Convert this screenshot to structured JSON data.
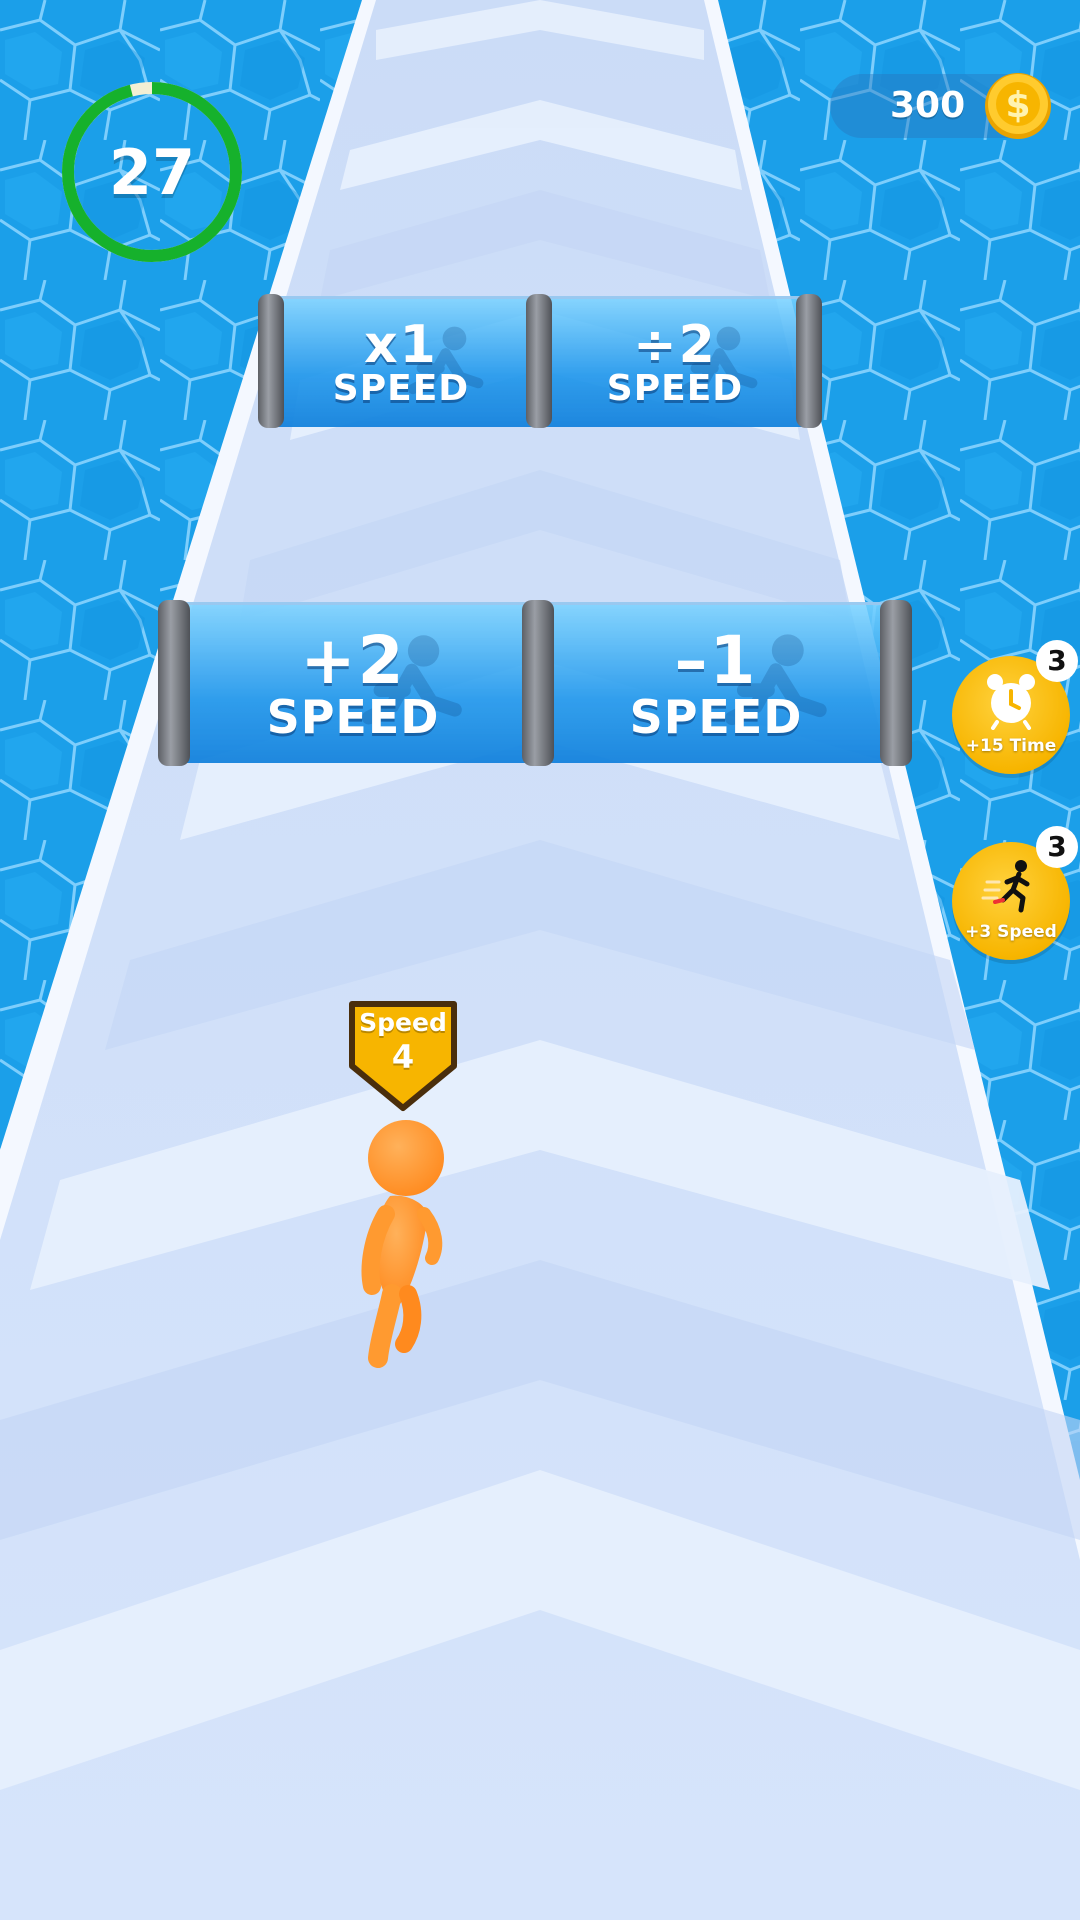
{
  "timer": {
    "seconds": "27",
    "remaining_fraction": 0.96
  },
  "currency": {
    "coins": "300",
    "icon": "dollar-coin-icon"
  },
  "gates": [
    {
      "row": "far",
      "side": "left",
      "value": "x1",
      "label": "SPEED"
    },
    {
      "row": "far",
      "side": "right",
      "value": "÷2",
      "label": "SPEED"
    },
    {
      "row": "near",
      "side": "left",
      "value": "+2",
      "label": "SPEED"
    },
    {
      "row": "near",
      "side": "right",
      "value": "–1",
      "label": "SPEED"
    }
  ],
  "powerups": [
    {
      "label": "+15 Time",
      "count": "3",
      "icon": "alarm-clock-icon"
    },
    {
      "label": "+3 Speed",
      "count": "3",
      "icon": "running-man-icon"
    }
  ],
  "player": {
    "speed_label": "Speed",
    "speed_value": "4"
  },
  "colors": {
    "water": "#1a9ee8",
    "track": "#dbe8fb",
    "timer_ring": "#16b12c",
    "gold": "#f7b500",
    "player": "#ff9a30"
  }
}
